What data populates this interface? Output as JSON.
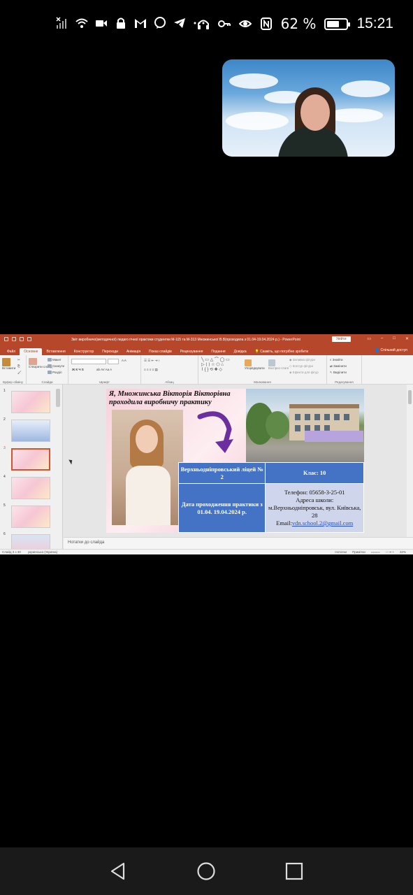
{
  "status_bar": {
    "battery_percent": "62 %",
    "battery_level": 0.62,
    "time": "15:21",
    "left_icons": [
      "signal-off-icon",
      "wifi-icon",
      "video-icon",
      "lock-icon",
      "gmail-icon",
      "viber-icon",
      "telegram-icon",
      "more-icon"
    ],
    "right_icons": [
      "headphones-icon",
      "key-icon",
      "eye-icon",
      "nfc-icon",
      "battery-icon"
    ]
  },
  "powerpoint": {
    "window_title": "Звіт виробничо(методичної) педаго гічної практики студентки М-115 та М-313 Множинської В.В(проходила з 01.04-19.04.2024 р.) - PowerPoint",
    "signin_label": "Увійти",
    "share_label": "Спільний доступ",
    "tabs": [
      "Файл",
      "Основне",
      "Вставлення",
      "Конструктор",
      "Переходи",
      "Анімація",
      "Показ слайдів",
      "Рецензування",
      "Подання",
      "Довідка",
      "Скажіть, що потрібно зробити"
    ],
    "active_tab": "Основне",
    "ribbon_groups": [
      "Буфер обміну",
      "Слайди",
      "Шрифт",
      "Абзац",
      "Малювання",
      "Редагування"
    ],
    "ribbon_buttons": {
      "paste": "Вставити",
      "new_slide": "Створити слайд",
      "layout": "Макет",
      "reset": "Скинути",
      "section": "Розділ",
      "arrange": "Упорядкувати",
      "quick_styles": "Експрес-стилі",
      "fill": "Заливка фігури",
      "outline": "Контур фігури",
      "effects": "Ефекти для фігур",
      "find": "Знайти",
      "replace": "Замінити",
      "select": "Виділити"
    },
    "slide_numbers": [
      "1",
      "2",
      "3",
      "4",
      "5",
      "6"
    ],
    "selected_slide": "3",
    "notes_placeholder": "Нотатки до слайда",
    "status_left": [
      "Слайд 3 з 30",
      "українська (Україна)"
    ],
    "status_right": [
      "Нотатки",
      "Примітки",
      "32%"
    ],
    "slide": {
      "title": "Я, Множинська Вікторія Вікторівна проходила виробничу практику",
      "table": {
        "school": "Верхньодніпровський ліцей № 2",
        "class": "Клас: 10",
        "dates": "Дата проходження практики з 01.04. 19.04.2024 р.",
        "phone": "Телефон: 05658-3-25-01",
        "address_label": "Адреса школи:",
        "address": "м.Верхньодніпровськ, вул. Київська, 28",
        "email_label": "Email:",
        "email": "vdn.school.2@gmail.com"
      }
    }
  },
  "nav_bar": {
    "buttons": [
      "back-icon",
      "home-icon",
      "recents-icon"
    ]
  },
  "colors": {
    "ppt_accent": "#b7472a",
    "table_blue": "#4472c4",
    "table_light": "#cfd5ea"
  }
}
